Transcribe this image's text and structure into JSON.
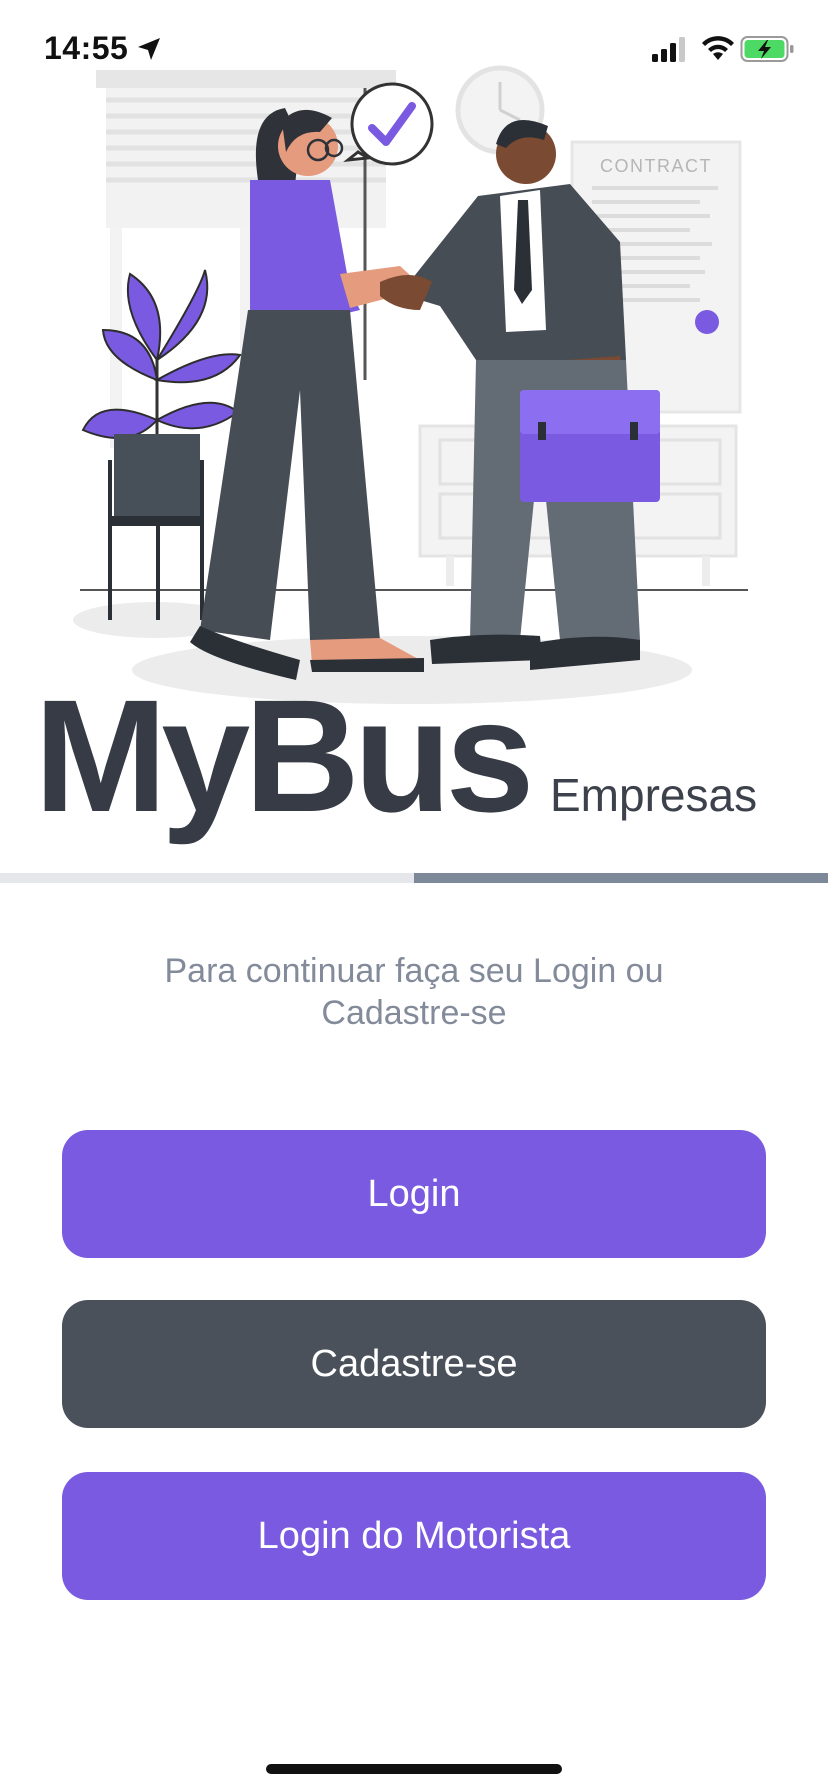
{
  "status_bar": {
    "time": "14:55",
    "icons": [
      "location-arrow-icon",
      "cellular-signal-icon",
      "wifi-icon",
      "battery-charging-icon"
    ],
    "battery_color": "#4cd964"
  },
  "hero": {
    "contract_label": "CONTRACT",
    "accent_color": "#7a5ae0"
  },
  "brand": {
    "name": "MyBus",
    "subtitle": "Empresas"
  },
  "progress": {
    "fraction": 0.5
  },
  "intro": {
    "text": "Para continuar faça seu Login ou Cadastre-se"
  },
  "buttons": {
    "login": "Login",
    "signup": "Cadastre-se",
    "driver_login": "Login do Motorista"
  },
  "colors": {
    "primary": "#7a5ae0",
    "secondary": "#4a515b",
    "brand_text": "#363b45",
    "muted_text": "#838b9b"
  }
}
